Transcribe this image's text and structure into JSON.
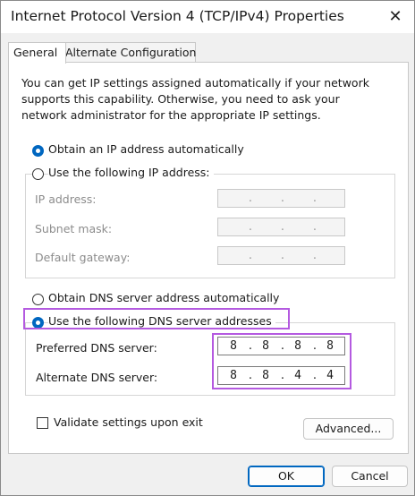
{
  "window": {
    "title": "Internet Protocol Version 4 (TCP/IPv4) Properties",
    "close_glyph": "✕"
  },
  "tabs": [
    {
      "label": "General",
      "active": true
    },
    {
      "label": "Alternate Configuration",
      "active": false
    }
  ],
  "description": "You can get IP settings assigned automatically if your network supports this capability. Otherwise, you need to ask your network administrator for the appropriate IP settings.",
  "ip_section": {
    "auto_label": "Obtain an IP address automatically",
    "auto_selected": true,
    "manual_label": "Use the following IP address:",
    "fields": [
      {
        "label": "IP address:",
        "octets": [
          "",
          "",
          "",
          ""
        ]
      },
      {
        "label": "Subnet mask:",
        "octets": [
          "",
          "",
          "",
          ""
        ]
      },
      {
        "label": "Default gateway:",
        "octets": [
          "",
          "",
          "",
          ""
        ]
      }
    ]
  },
  "dns_section": {
    "auto_label": "Obtain DNS server address automatically",
    "manual_label": "Use the following DNS server addresses",
    "manual_selected": true,
    "fields": [
      {
        "label": "Preferred DNS server:",
        "octets": [
          "8",
          "8",
          "8",
          "8"
        ]
      },
      {
        "label": "Alternate DNS server:",
        "octets": [
          "8",
          "8",
          "4",
          "4"
        ]
      }
    ]
  },
  "validate_label": "Validate settings upon exit",
  "advanced_label": "Advanced...",
  "ok_label": "OK",
  "cancel_label": "Cancel",
  "highlight_color": "#b45ae0",
  "accent_color": "#0067c0"
}
